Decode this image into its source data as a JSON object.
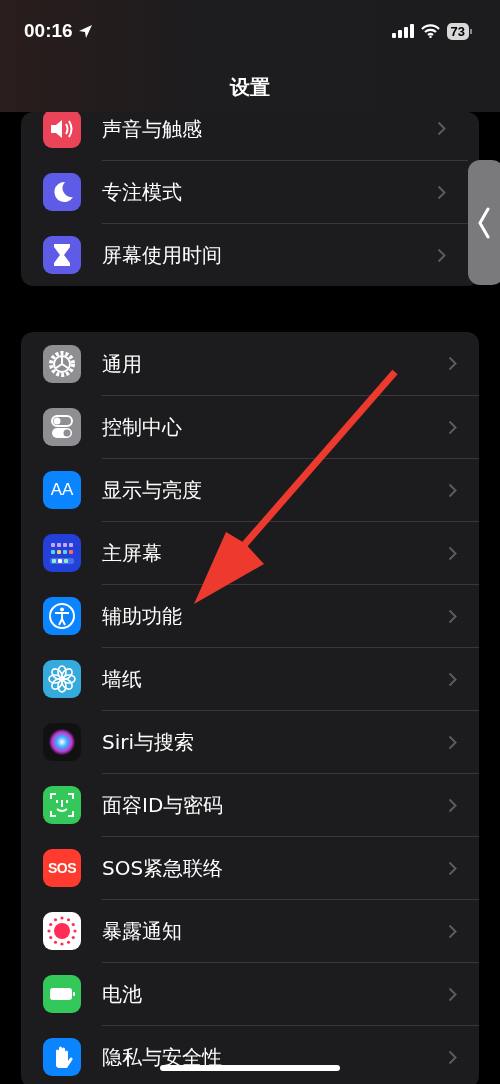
{
  "status_bar": {
    "time": "00:16",
    "battery": "73"
  },
  "title": "设置",
  "groups": [
    {
      "items": [
        {
          "label": "声音与触感"
        },
        {
          "label": "专注模式"
        },
        {
          "label": "屏幕使用时间"
        }
      ]
    },
    {
      "items": [
        {
          "label": "通用"
        },
        {
          "label": "控制中心"
        },
        {
          "label": "显示与亮度",
          "icon_text": "AA"
        },
        {
          "label": "主屏幕"
        },
        {
          "label": "辅助功能"
        },
        {
          "label": "墙纸"
        },
        {
          "label": "Siri与搜索"
        },
        {
          "label": "面容ID与密码"
        },
        {
          "label": "SOS紧急联络",
          "icon_text": "SOS"
        },
        {
          "label": "暴露通知"
        },
        {
          "label": "电池"
        },
        {
          "label": "隐私与安全性"
        }
      ]
    }
  ]
}
